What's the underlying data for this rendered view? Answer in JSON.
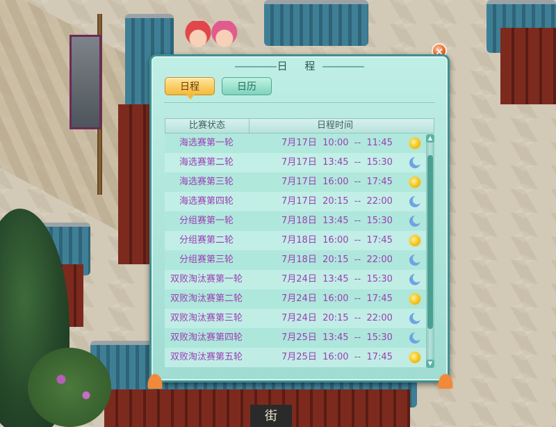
{
  "dialog": {
    "title": "日 程",
    "close_symbol": "×"
  },
  "tabs": [
    {
      "label": "日程",
      "active": true
    },
    {
      "label": "日历",
      "active": false
    }
  ],
  "table": {
    "headers": {
      "status": "比赛状态",
      "time": "日程时间"
    },
    "rows": [
      {
        "status": "海选赛第一轮",
        "time": "7月17日  10:00  --  11:45",
        "icon": "sun"
      },
      {
        "status": "海选赛第二轮",
        "time": "7月17日  13:45  --  15:30",
        "icon": "moon"
      },
      {
        "status": "海选赛第三轮",
        "time": "7月17日  16:00  --  17:45",
        "icon": "sun"
      },
      {
        "status": "海选赛第四轮",
        "time": "7月17日  20:15  --  22:00",
        "icon": "moon"
      },
      {
        "status": "分组赛第一轮",
        "time": "7月18日  13:45  --  15:30",
        "icon": "moon"
      },
      {
        "status": "分组赛第二轮",
        "time": "7月18日  16:00  --  17:45",
        "icon": "sun"
      },
      {
        "status": "分组赛第三轮",
        "time": "7月18日  20:15  --  22:00",
        "icon": "moon"
      },
      {
        "status": "双败淘汰赛第一轮",
        "time": "7月24日  13:45  --  15:30",
        "icon": "moon"
      },
      {
        "status": "双败淘汰赛第二轮",
        "time": "7月24日  16:00  --  17:45",
        "icon": "sun"
      },
      {
        "status": "双败淘汰赛第三轮",
        "time": "7月24日  20:15  --  22:00",
        "icon": "moon"
      },
      {
        "status": "双败淘汰赛第四轮",
        "time": "7月25日  13:45  --  15:30",
        "icon": "moon"
      },
      {
        "status": "双败淘汰赛第五轮",
        "time": "7月25日  16:00  --  17:45",
        "icon": "sun"
      }
    ]
  },
  "scene": {
    "sign_text": "街"
  },
  "colors": {
    "accent": "#f5b93a",
    "row_text": "#9b3fb5",
    "panel": "#a9e3d9"
  }
}
